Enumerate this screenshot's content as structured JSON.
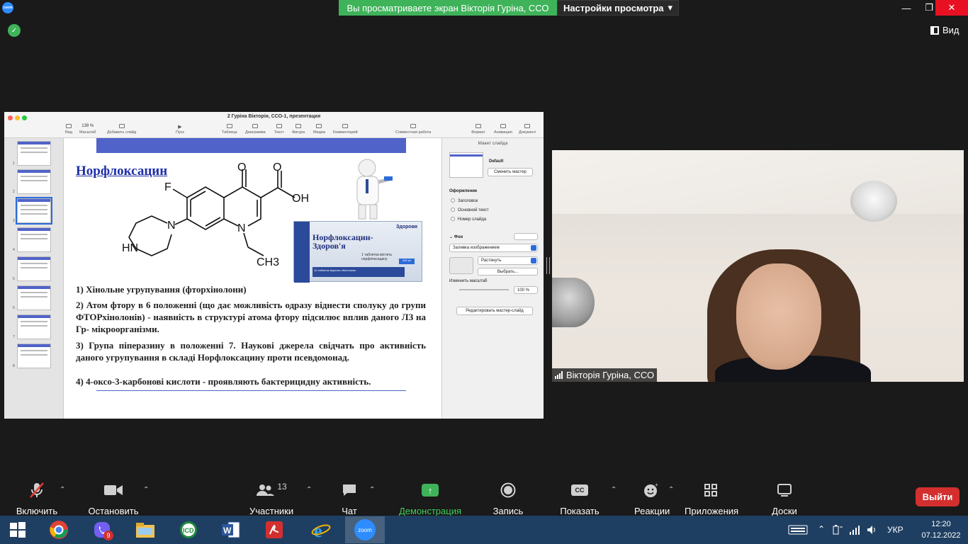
{
  "topbar": {
    "app_logo_text": "zoom",
    "share_banner": "Вы просматриваете экран Вікторія Гуріна, ССО",
    "view_options": "Настройки просмотра",
    "view_button": "Вид"
  },
  "shared_app": {
    "doc_title": "2 Гуріна Вікторія, ССО-1, презентация",
    "toolbar": [
      {
        "label": "Вид"
      },
      {
        "label": "Масштаб",
        "value": "139 %"
      },
      {
        "label": "Добавить слайд"
      },
      {
        "label": "Пуск"
      },
      {
        "label": "Таблица"
      },
      {
        "label": "Диаграмма"
      },
      {
        "label": "Текст"
      },
      {
        "label": "Фигура"
      },
      {
        "label": "Медиа"
      },
      {
        "label": "Комментарий"
      },
      {
        "label": "Совместная работа"
      },
      {
        "label": "Формат"
      },
      {
        "label": "Анимация"
      },
      {
        "label": "Документ"
      }
    ],
    "thumb_numbers": [
      "1",
      "2",
      "3",
      "4",
      "5",
      "6",
      "7",
      "8"
    ],
    "slide": {
      "title": "Норфлоксацин",
      "chem_labels": {
        "o1": "O",
        "o2": "O",
        "oh": "OH",
        "f": "F",
        "n1": "N",
        "n2": "N",
        "hn": "HN",
        "ch3": "CH3"
      },
      "box_brand": "Здоровя",
      "box_name_line1": "Норфлоксацин-",
      "box_name_line2": "Здоров'я",
      "box_dose": "1 таблетка містить норфлоксацину",
      "box_badge": "400 мг",
      "box_bottom": "10 таблеток вкритих оболонкою",
      "points": [
        "1) Хінольне угрупування (фторхінолони)",
        "2) Атом фтору в 6 положенні (що дає можливість одразу віднести сполуку до групи ФТОРхінолонів) - наявність в структурі атома фтору підсилює вплив даного ЛЗ на Гр- мікроорганізми.",
        "3) Група піперазину в положенні 7. Наукові джерела свідчать про активність даного угрупування в складі Норфлоксацину проти псевдомонад.",
        "4) 4-оксо-3-карбонові кислоти - проявляють бактерицидну активність."
      ]
    },
    "panel": {
      "header": "Макет слайда",
      "layout_name": "Default",
      "change_master": "Сменить мастер",
      "appearance_label": "Оформление",
      "options": [
        "Заголовок",
        "Основной текст",
        "Номер слайда"
      ],
      "bg_label": "Фон",
      "bg_fill": "Заливка изображением",
      "stretch": "Растянуть",
      "choose": "Выбрать...",
      "scale_label": "Изменить масштаб",
      "scale_value": "100 %",
      "edit_master": "Редактировать мастер-слайд"
    }
  },
  "video": {
    "participant_name": "Вікторія Гуріна, ССО"
  },
  "toolbar": {
    "items": [
      {
        "label": "Включить звук",
        "icon": "mic-muted-icon"
      },
      {
        "label": "Остановить видео",
        "icon": "video-camera-icon"
      },
      {
        "label": "Участники",
        "icon": "participants-icon",
        "count": "13"
      },
      {
        "label": "Чат",
        "icon": "chat-icon"
      },
      {
        "label": "Демонстрация экрана",
        "icon": "share-screen-icon"
      },
      {
        "label": "Запись",
        "icon": "record-icon"
      },
      {
        "label": "Показать субтитры",
        "icon": "cc-icon",
        "icon_text": "CC"
      },
      {
        "label": "Реакции",
        "icon": "reactions-icon"
      },
      {
        "label": "Приложения",
        "icon": "apps-icon"
      },
      {
        "label": "Доски сообщений",
        "icon": "whiteboard-icon"
      }
    ],
    "leave": "Выйти",
    "share_color": "#3fb35a",
    "leave_color": "#d32f2f"
  },
  "taskbar": {
    "viber_badge": "9",
    "zoom_label": "zoom",
    "lang": "УКР",
    "time": "12:20",
    "date": "07.12.2022"
  }
}
